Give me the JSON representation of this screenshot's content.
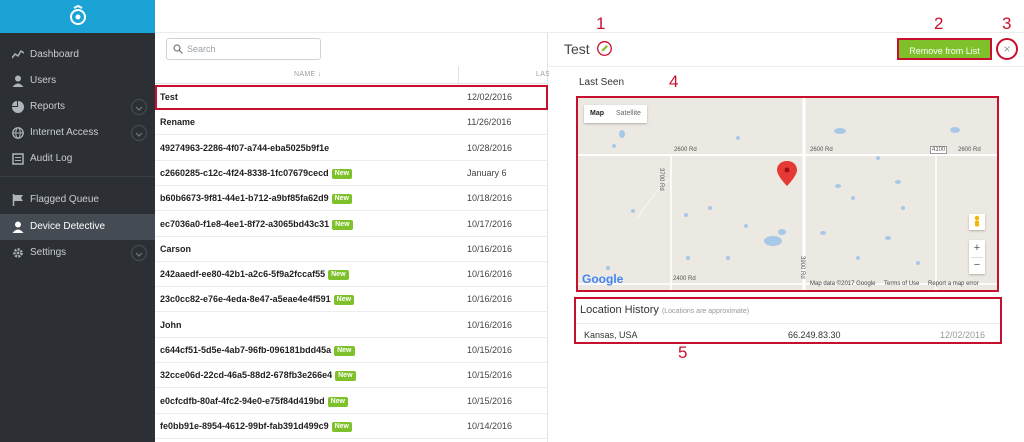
{
  "sidebar": {
    "items": [
      {
        "label": "Dashboard",
        "icon": "chart-line-icon"
      },
      {
        "label": "Users",
        "icon": "user-icon"
      },
      {
        "label": "Reports",
        "icon": "pie-chart-icon"
      },
      {
        "label": "Internet Access",
        "icon": "globe-icon"
      },
      {
        "label": "Audit Log",
        "icon": "log-icon"
      },
      {
        "label": "Flagged Queue",
        "icon": "flag-icon"
      },
      {
        "label": "Device Detective",
        "icon": "user-icon"
      },
      {
        "label": "Settings",
        "icon": "gear-icon"
      }
    ],
    "active": "Device Detective"
  },
  "search": {
    "placeholder": "Search"
  },
  "list": {
    "col_name": "NAME",
    "col_last": "LAS",
    "rows": [
      {
        "name": "Test",
        "date": "12/02/2016",
        "new": false
      },
      {
        "name": "Rename",
        "date": "11/26/2016",
        "new": false
      },
      {
        "name": "49274963-2286-4f07-a744-eba5025b9f1e",
        "date": "10/28/2016",
        "new": false
      },
      {
        "name": "c2660285-c12c-4f24-8338-1fc07679cecd",
        "date": "January 6",
        "new": true
      },
      {
        "name": "b60b6673-9f81-44e1-b712-a9bf85fa62d9",
        "date": "10/18/2016",
        "new": true
      },
      {
        "name": "ec7036a0-f1e8-4ee1-8f72-a3065bd43c31",
        "date": "10/17/2016",
        "new": true
      },
      {
        "name": "Carson",
        "date": "10/16/2016",
        "new": false
      },
      {
        "name": "242aaedf-ee80-42b1-a2c6-5f9a2fccaf55",
        "date": "10/16/2016",
        "new": true
      },
      {
        "name": "23c0cc82-e76e-4eda-8e47-a5eae4e4f591",
        "date": "10/16/2016",
        "new": true
      },
      {
        "name": "John",
        "date": "10/16/2016",
        "new": false
      },
      {
        "name": "c644cf51-5d5e-4ab7-96fb-096181bdd45a",
        "date": "10/15/2016",
        "new": true
      },
      {
        "name": "32cce06d-22cd-46a5-88d2-678fb3e266e4",
        "date": "10/15/2016",
        "new": true
      },
      {
        "name": "e0cfcdfb-80af-4fc2-94e0-e75f84d419bd",
        "date": "10/15/2016",
        "new": true
      },
      {
        "name": "fe0bb91e-8954-4612-99bf-fab391d499c9",
        "date": "10/14/2016",
        "new": true
      }
    ],
    "badge_label": "New"
  },
  "detail": {
    "title": "Test",
    "remove_label": "Remove from List",
    "close_label": "×",
    "last_seen_label": "Last Seen",
    "map": {
      "map_label": "Map",
      "satellite_label": "Satellite",
      "road_labels": [
        "2600 Rd",
        "2600 Rd",
        "2600 Rd",
        "4100",
        "3700 Rd",
        "3900 Rd",
        "2400 Rd"
      ],
      "google": "Google",
      "attribution": [
        "Map data ©2017 Google",
        "Terms of Use",
        "Report a map error"
      ],
      "zoom_in": "+",
      "zoom_out": "−"
    },
    "location_history": {
      "title": "Location History",
      "subtitle": "(Locations are approximate)",
      "entries": [
        {
          "place": "Kansas, USA",
          "ip": "66.249.83.30",
          "date": "12/02/2016"
        }
      ]
    }
  },
  "annotations": [
    "1",
    "2",
    "3",
    "4",
    "5"
  ],
  "colors": {
    "sidebar": "#2c3035",
    "brand": "#1aa3d4",
    "accent": "#7ec12a",
    "highlight": "#c8102e"
  }
}
